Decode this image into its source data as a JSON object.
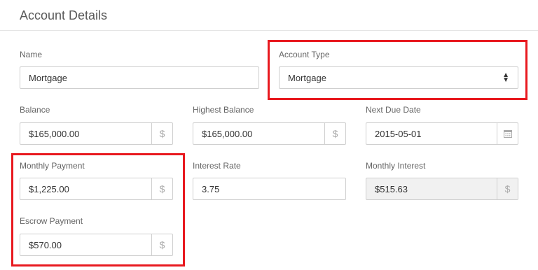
{
  "panel": {
    "title": "Account Details"
  },
  "fields": {
    "name": {
      "label": "Name",
      "value": "Mortgage"
    },
    "account_type": {
      "label": "Account Type",
      "value": "Mortgage"
    },
    "balance": {
      "label": "Balance",
      "value": "$165,000.00",
      "addon": "$"
    },
    "highest_balance": {
      "label": "Highest Balance",
      "value": "$165,000.00",
      "addon": "$"
    },
    "next_due_date": {
      "label": "Next Due Date",
      "value": "2015-05-01",
      "addon_icon": "calendar-icon"
    },
    "monthly_payment": {
      "label": "Monthly Payment",
      "value": "$1,225.00",
      "addon": "$"
    },
    "interest_rate": {
      "label": "Interest Rate",
      "value": "3.75"
    },
    "monthly_interest": {
      "label": "Monthly Interest",
      "value": "$515.63",
      "addon": "$"
    },
    "escrow_payment": {
      "label": "Escrow Payment",
      "value": "$570.00",
      "addon": "$"
    }
  },
  "colors": {
    "highlight": "#e8191f",
    "border": "#cfcfcf",
    "readonly_bg": "#f1f1f1"
  }
}
